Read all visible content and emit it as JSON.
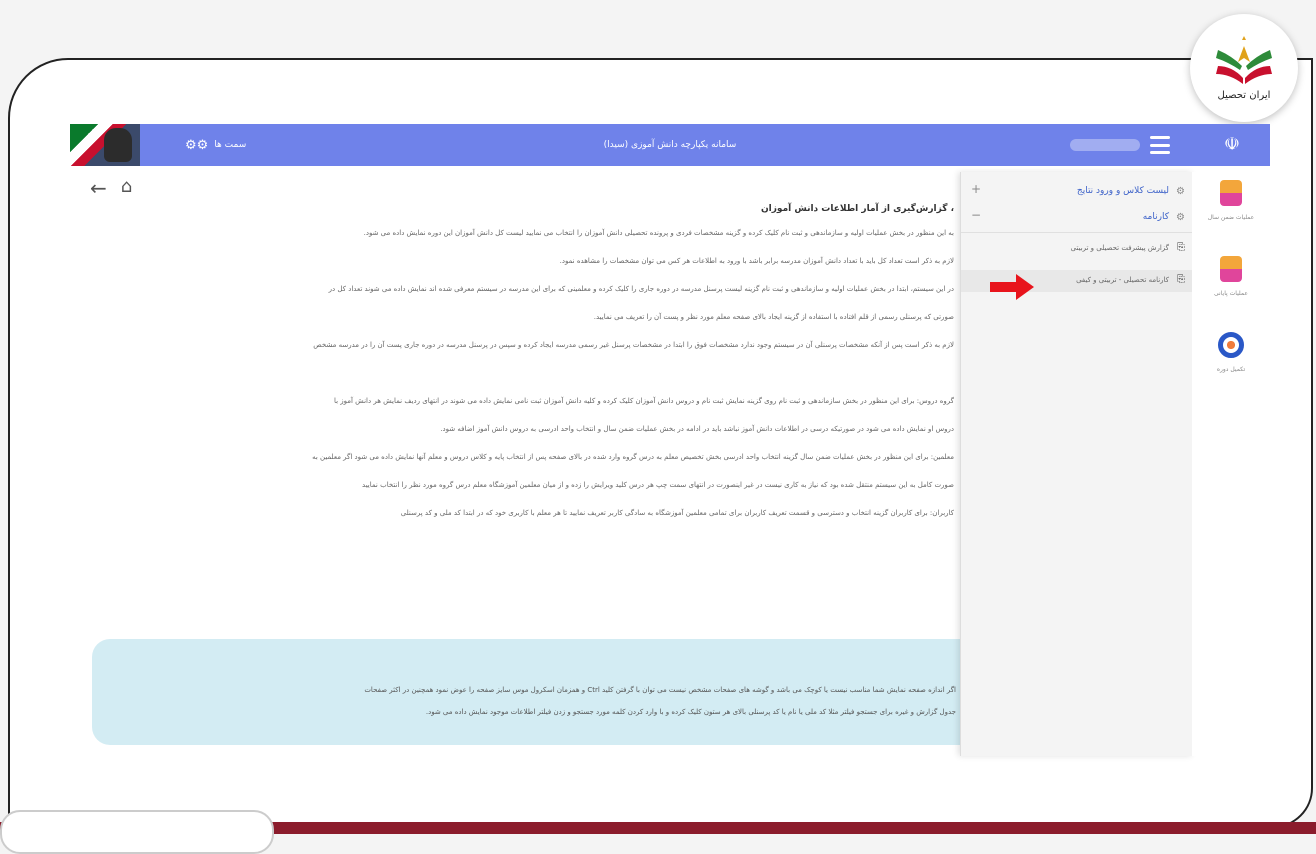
{
  "brand": {
    "name": "ایران تحصیل",
    "colors": {
      "green": "#2e8b3a",
      "red": "#c8102e",
      "gold": "#e0a21b"
    }
  },
  "app": {
    "title": "سامانه یکپارچه دانش آموزی (سیدا)",
    "roles_label": "سمت ها",
    "header_color": "#6f82ea"
  },
  "nav": {
    "back_icon": "arrow-left-icon",
    "home_icon": "home-icon"
  },
  "content": {
    "heading": "گزارش‌گیری از آمار اطلاعات دانش آموزان ،",
    "paragraphs": [
      "به این منظور در بخش عملیات اولیه و سازماندهی و ثبت نام کلیک کرده و گزینه مشخصات فردی و پرونده تحصیلی دانش آموزان را انتخاب می نمایید لیست کل دانش آموزان این دوره نمایش داده می شود.",
      "لازم به ذکر است تعداد کل باید با تعداد دانش آموزان مدرسه برابر باشد با ورود به اطلاعات هر کس می توان مشخصات را مشاهده نمود.",
      "در این سیستم، ابتدا در بخش عملیات اولیه و سازماندهی و ثبت نام گزینه لیست پرسنل مدرسه در دوره جاری را کلیک کرده و معلمینی که برای این مدرسه در سیستم معرفی شده اند نمایش داده می شوند تعداد کل در",
      "صورتی که پرسنلی رسمی از قلم افتاده با استفاده از گزینه ایجاد بالای صفحه معلم مورد نظر و پست آن را تعریف می نمایید.",
      "لازم به ذکر است پس از آنکه مشخصات پرسنلی آن در سیستم وجود ندارد مشخصات فوق را ابتدا در مشخصات پرسنل غیر رسمی مدرسه ایجاد کرده و سپس در پرسنل مدرسه در دوره جاری پست آن را در مدرسه مشخص",
      "",
      "گروه دروس: برای این منظور در بخش سازماندهی و ثبت نام روی گزینه نمایش ثبت نام و دروس دانش آموزان کلیک کرده و کلیه دانش آموزان ثبت نامی نمایش داده می شوند در انتهای ردیف نمایش هر دانش آموز با",
      "دروس او نمایش داده می شود در صورتیکه درسی در اطلاعات دانش آموز نباشد باید در ادامه در بخش عملیات ضمن سال و انتخاب واحد ادرسی به دروس دانش آموز اضافه شود.",
      "معلمین: برای این منظور در بخش عملیات ضمن سال گزینه انتخاب واحد ادرسی بخش تخصیص معلم به درس گروه وارد شده در بالای صفحه پس از انتخاب پایه و کلاس دروس و معلم آنها نمایش داده می شود اگر معلمین به",
      "صورت کامل به این سیستم منتقل شده بود که نیاز به کاری نیست در غیر اینصورت در انتهای سمت چپ هر درس کلید ویرایش را زده و از میان معلمین آموزشگاه معلم درس گروه مورد نظر را انتخاب نمایید",
      "کاربران: برای کاربران گزینه انتخاب و دسترسی و قسمت تعریف کاربران برای تمامی معلمین آموزشگاه به سادگی کاربر تعریف نمایید تا هر معلم با کاربری خود که در ابتدا کد ملی و کد پرسنلی"
    ],
    "info_lines": [
      "اگر اندازه صفحه نمایش شما مناسب نیست یا کوچک می باشد و گوشه های صفحات مشخص نیست می توان با گرفتن کلید Ctrl و همزمان اسکرول موس سایز صفحه را عوض نمود همچنین در اکثر صفحات",
      "جدول گزارش و غیره برای جستجو فیلتر مثلا کد ملی یا نام یا کد پرسنلی بالای هر ستون کلیک کرده و با وارد کردن کلمه مورد جستجو و زدن فیلتر اطلاعات موجود نمایش داده می شود."
    ]
  },
  "submenu": {
    "items": [
      {
        "label": "لیست کلاس و ورود نتایج",
        "toggle": "+"
      },
      {
        "label": "کارنامه",
        "toggle": "−"
      }
    ],
    "subitems": [
      {
        "label": "گزارش پیشرفت تحصیلی و تربیتی"
      },
      {
        "label": "کارنامه تحصیلی - تربیتی و کیفی"
      }
    ]
  },
  "sidebar": {
    "items": [
      {
        "label": "عملیات ضمن سال",
        "icon": "database-icon"
      },
      {
        "label": "عملیات پایانی",
        "icon": "database-icon"
      },
      {
        "label": "تکمیل دوره",
        "icon": "gear-icon"
      }
    ]
  }
}
